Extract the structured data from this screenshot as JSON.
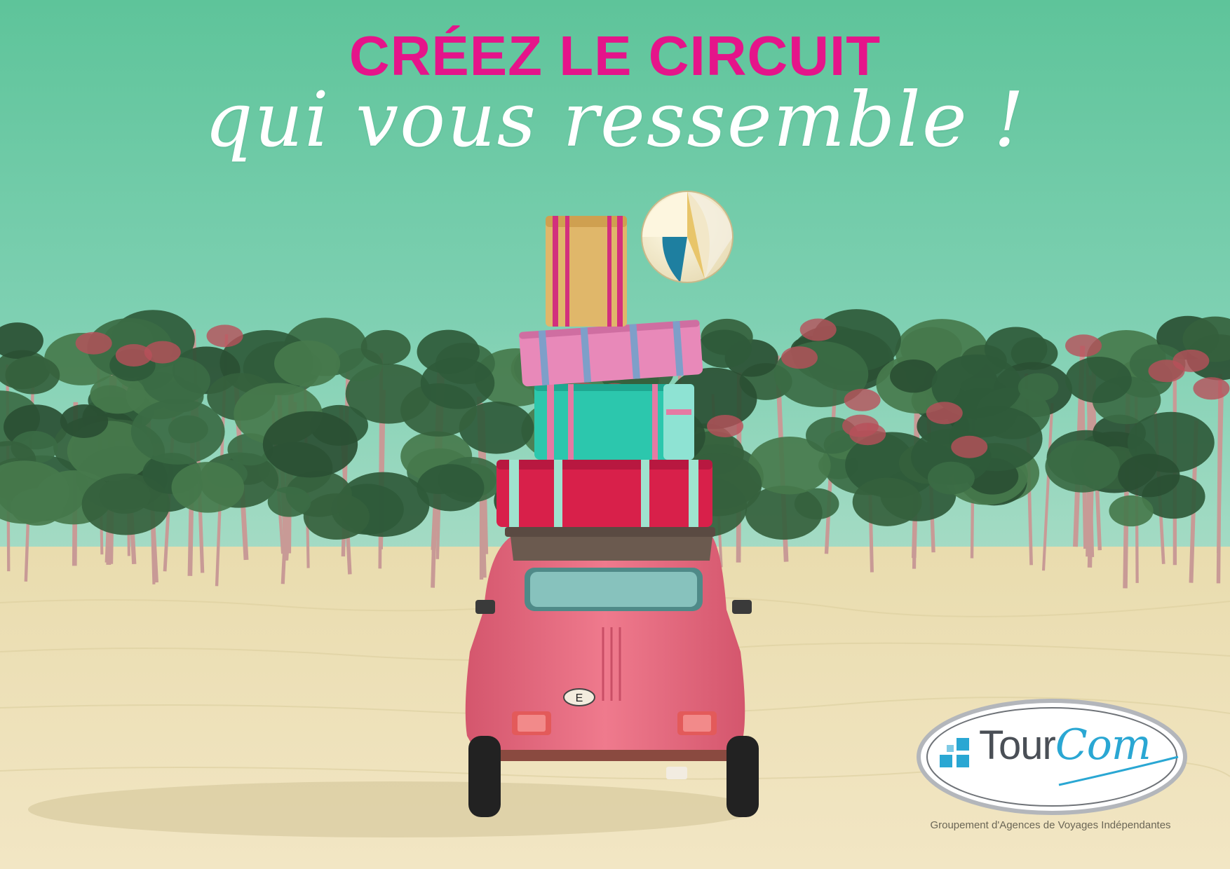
{
  "headline": {
    "line1": "CRÉEZ LE CIRCUIT",
    "line2": "qui vous ressemble !"
  },
  "logo": {
    "brand_main": "Tour",
    "brand_script": "Com",
    "tagline": "Groupement d'Agences de Voyages Indépendantes"
  },
  "car": {
    "plate_letter": "E"
  },
  "colors": {
    "headline_pink": "#e5148a",
    "sky": "#6fcaa6",
    "sand": "#efe4bd",
    "car_pink": "#e8687e",
    "logo_blue": "#2aa7d3",
    "logo_grey": "#4a4f56"
  }
}
